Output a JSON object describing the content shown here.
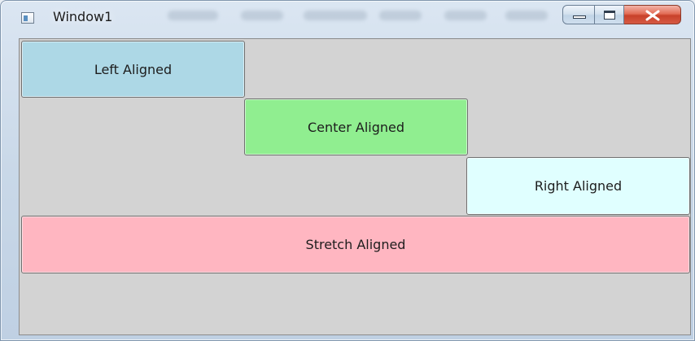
{
  "window": {
    "title": "Window1"
  },
  "buttons": {
    "left": {
      "label": "Left Aligned",
      "color": "#add8e6"
    },
    "center": {
      "label": "Center Aligned",
      "color": "#90ee90"
    },
    "right": {
      "label": "Right Aligned",
      "color": "#e0ffff"
    },
    "stretch": {
      "label": "Stretch Aligned",
      "color": "#ffb6c1"
    }
  },
  "client": {
    "background": "#d3d3d3"
  },
  "icons": {
    "app": "window-app-icon",
    "minimize": "minimize-icon",
    "maximize": "maximize-icon",
    "close": "close-icon"
  }
}
